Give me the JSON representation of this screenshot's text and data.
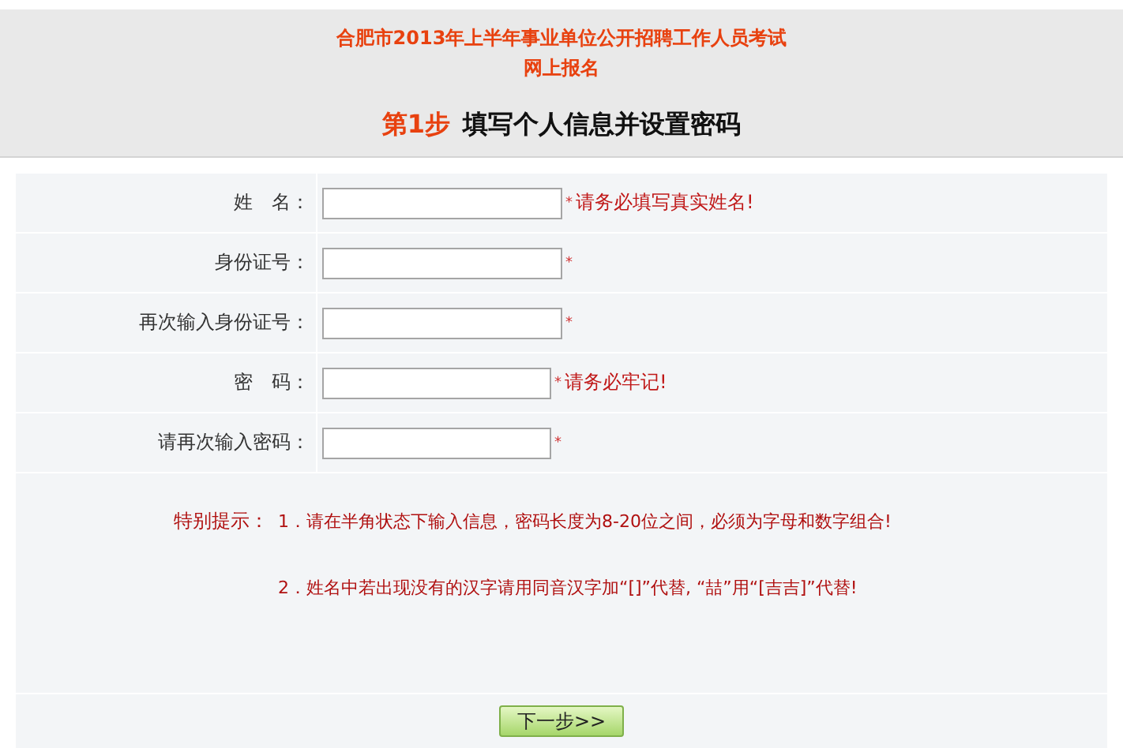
{
  "header": {
    "title_lines": [
      "合肥市2013年上半年事业单位公开招聘工作人员考试",
      "网上报名"
    ],
    "step_label": "第1步",
    "step_title": "填写个人信息并设置密码"
  },
  "fields": [
    {
      "label": "姓　名：",
      "required_mark": "*",
      "hint": "请务必填写真实姓名!",
      "kind": "text"
    },
    {
      "label": "身份证号：",
      "required_mark": "*",
      "kind": "text"
    },
    {
      "label": "再次输入身份证号：",
      "required_mark": "*",
      "kind": "text"
    },
    {
      "label": "密　码：",
      "required_mark": "*",
      "hint": "请务必牢记!",
      "kind": "password"
    },
    {
      "label": "请再次输入密码：",
      "required_mark": "*",
      "kind": "password"
    }
  ],
  "notes": {
    "heading": "特别提示：",
    "items": [
      "1．请在半角状态下输入信息，密码长度为8-20位之间，必须为字母和数字组合!",
      "2．姓名中若出现没有的汉字请用同音汉字加“[]”代替, “喆”用“[吉吉]”代替!"
    ]
  },
  "next_button": "下一步>>"
}
